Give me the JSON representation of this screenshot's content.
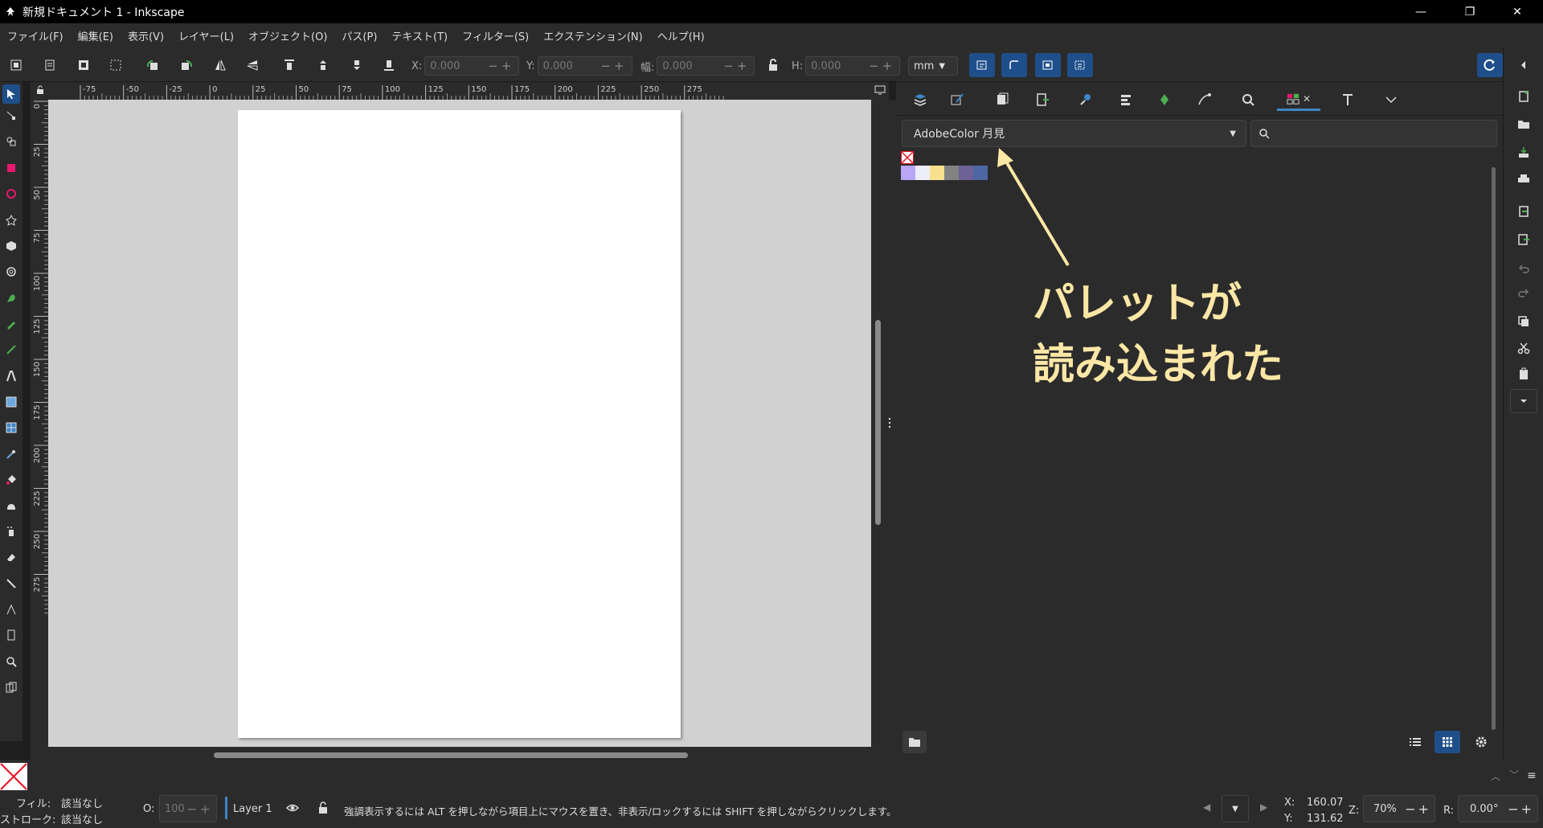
{
  "window": {
    "title": "新規ドキュメント 1 - Inkscape",
    "minimize": "—",
    "maximize": "❐",
    "close": "✕"
  },
  "menu": [
    "ファイル(F)",
    "編集(E)",
    "表示(V)",
    "レイヤー(L)",
    "オブジェクト(O)",
    "パス(P)",
    "テキスト(T)",
    "フィルター(S)",
    "エクステンション(N)",
    "ヘルプ(H)"
  ],
  "toolbar": {
    "x_label": "X:",
    "x_value": "0.000",
    "y_label": "Y:",
    "y_value": "0.000",
    "w_label": "幅:",
    "w_value": "0.000",
    "h_label": "H:",
    "h_value": "0.000",
    "unit": "mm"
  },
  "ruler": {
    "h_ticks": [
      "-75",
      "-50",
      "-25",
      "0",
      "25",
      "50",
      "75",
      "100",
      "125",
      "150",
      "175",
      "200",
      "225",
      "250",
      "275"
    ],
    "v_ticks": [
      "0",
      "25",
      "50",
      "75",
      "100",
      "125",
      "150",
      "175",
      "200",
      "225",
      "250",
      "275"
    ]
  },
  "swatches": {
    "panel": {
      "palette_name": "AdobeColor 月見",
      "search_placeholder": ""
    },
    "colors": [
      "#b9a6f5",
      "#eeeefa",
      "#f6e08d",
      "#838383",
      "#6e6195",
      "#4c67a3"
    ],
    "none_color": "#e81123"
  },
  "annotation": {
    "line1": "パレットが",
    "line2": "読み込まれた",
    "color": "#fde7a6"
  },
  "status": {
    "fill_label": "フィル:",
    "fill_value": "該当なし",
    "stroke_label": "ストローク:",
    "stroke_value": "該当なし",
    "opacity_label": "O:",
    "opacity_value": "100",
    "layer": "Layer 1",
    "message": "強調表示するには ALT を押しながら項目上にマウスを置き、非表示/ロックするには SHIFT を押しながらクリックします。",
    "x_label": "X:",
    "x_value": "160.07",
    "y_label": "Y:",
    "y_value": "131.62",
    "zoom_label": "Z:",
    "zoom_value": "70%",
    "rot_label": "R:",
    "rot_value": "0.00°"
  }
}
